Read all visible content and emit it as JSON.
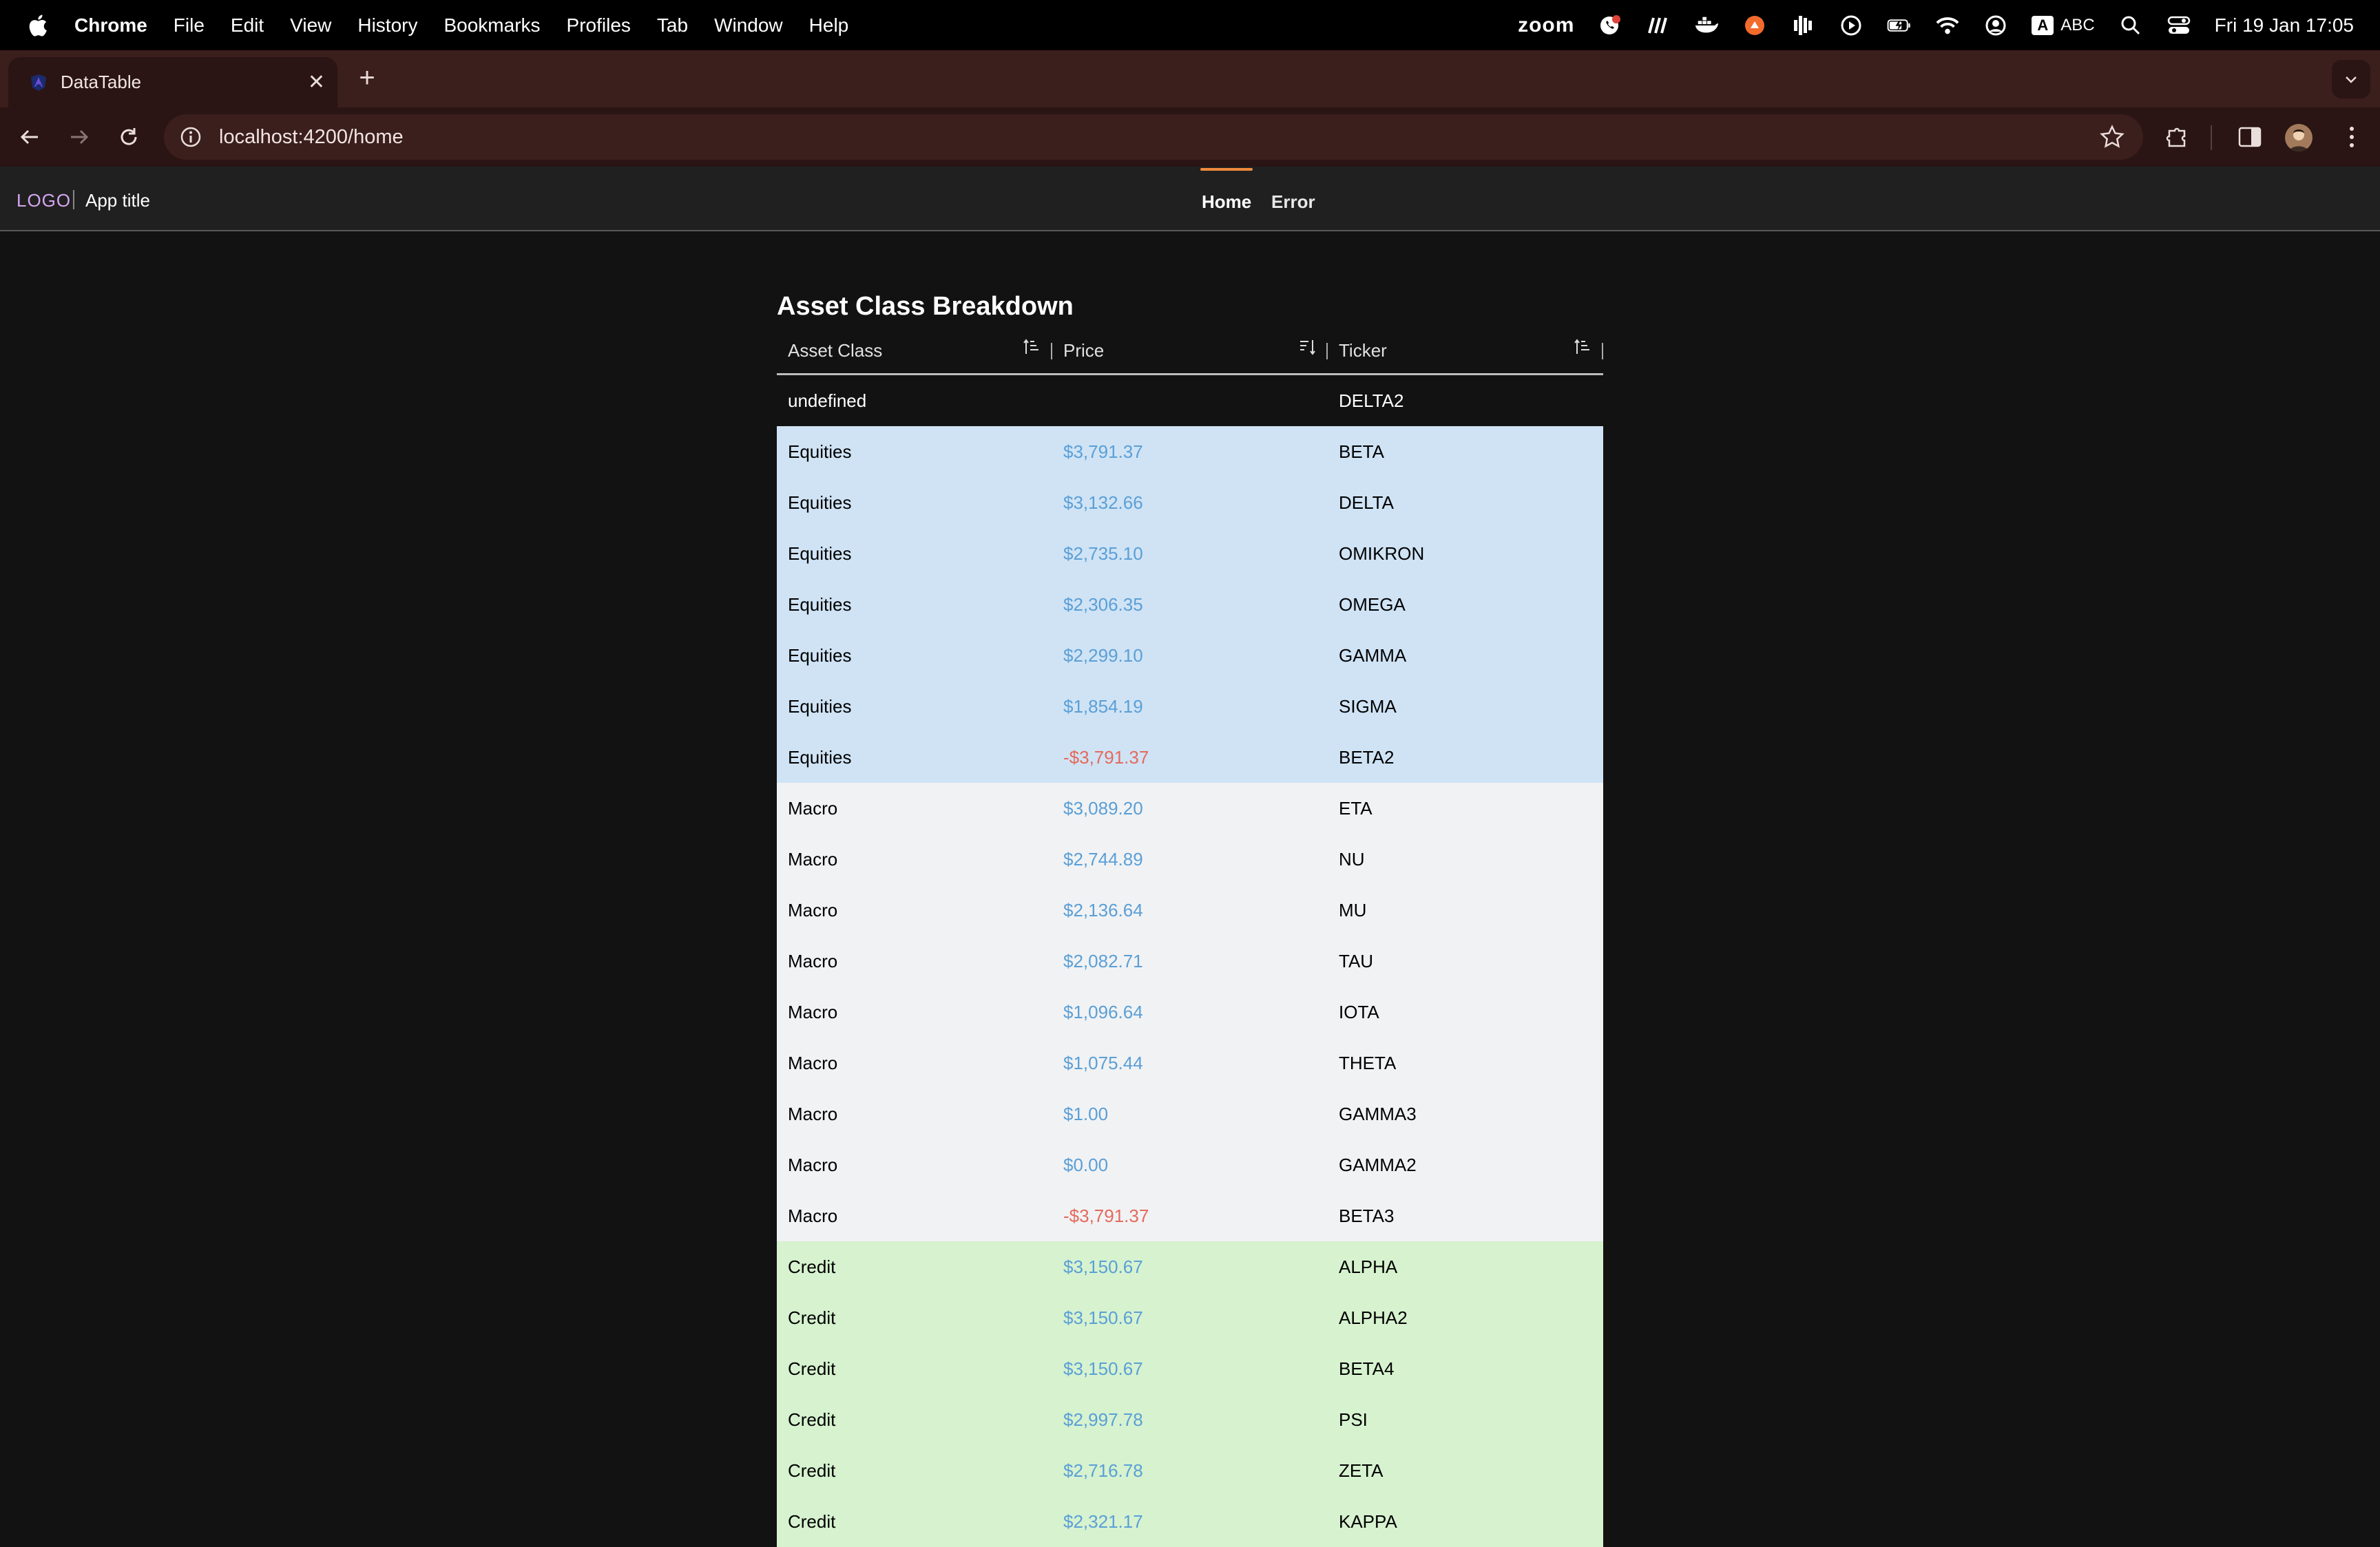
{
  "menubar": {
    "app_name": "Chrome",
    "items": [
      "File",
      "Edit",
      "View",
      "History",
      "Bookmarks",
      "Profiles",
      "Tab",
      "Window",
      "Help"
    ],
    "status": {
      "zoom_label": "zoom",
      "input_badge": "A",
      "input_label": "ABC",
      "clock": "Fri 19 Jan  17:05"
    }
  },
  "browser": {
    "tab_title": "DataTable",
    "url": "localhost:4200/home"
  },
  "app": {
    "logo": "LOGO",
    "title": "App title",
    "nav": [
      {
        "label": "Home",
        "active": true
      },
      {
        "label": "Error",
        "active": false
      }
    ]
  },
  "table": {
    "title": "Asset Class Breakdown",
    "columns": [
      "Asset Class",
      "Price",
      "Ticker"
    ],
    "rows": [
      {
        "asset_class": "undefined",
        "price": "",
        "ticker": "DELTA2",
        "group": "none"
      },
      {
        "asset_class": "Equities",
        "price": "$3,791.37",
        "ticker": "BETA",
        "group": "equities"
      },
      {
        "asset_class": "Equities",
        "price": "$3,132.66",
        "ticker": "DELTA",
        "group": "equities"
      },
      {
        "asset_class": "Equities",
        "price": "$2,735.10",
        "ticker": "OMIKRON",
        "group": "equities"
      },
      {
        "asset_class": "Equities",
        "price": "$2,306.35",
        "ticker": "OMEGA",
        "group": "equities"
      },
      {
        "asset_class": "Equities",
        "price": "$2,299.10",
        "ticker": "GAMMA",
        "group": "equities"
      },
      {
        "asset_class": "Equities",
        "price": "$1,854.19",
        "ticker": "SIGMA",
        "group": "equities"
      },
      {
        "asset_class": "Equities",
        "price": "-$3,791.37",
        "ticker": "BETA2",
        "group": "equities"
      },
      {
        "asset_class": "Macro",
        "price": "$3,089.20",
        "ticker": "ETA",
        "group": "macro"
      },
      {
        "asset_class": "Macro",
        "price": "$2,744.89",
        "ticker": "NU",
        "group": "macro"
      },
      {
        "asset_class": "Macro",
        "price": "$2,136.64",
        "ticker": "MU",
        "group": "macro"
      },
      {
        "asset_class": "Macro",
        "price": "$2,082.71",
        "ticker": "TAU",
        "group": "macro"
      },
      {
        "asset_class": "Macro",
        "price": "$1,096.64",
        "ticker": "IOTA",
        "group": "macro"
      },
      {
        "asset_class": "Macro",
        "price": "$1,075.44",
        "ticker": "THETA",
        "group": "macro"
      },
      {
        "asset_class": "Macro",
        "price": "$1.00",
        "ticker": "GAMMA3",
        "group": "macro"
      },
      {
        "asset_class": "Macro",
        "price": "$0.00",
        "ticker": "GAMMA2",
        "group": "macro"
      },
      {
        "asset_class": "Macro",
        "price": "-$3,791.37",
        "ticker": "BETA3",
        "group": "macro"
      },
      {
        "asset_class": "Credit",
        "price": "$3,150.67",
        "ticker": "ALPHA",
        "group": "credit"
      },
      {
        "asset_class": "Credit",
        "price": "$3,150.67",
        "ticker": "ALPHA2",
        "group": "credit"
      },
      {
        "asset_class": "Credit",
        "price": "$3,150.67",
        "ticker": "BETA4",
        "group": "credit"
      },
      {
        "asset_class": "Credit",
        "price": "$2,997.78",
        "ticker": "PSI",
        "group": "credit"
      },
      {
        "asset_class": "Credit",
        "price": "$2,716.78",
        "ticker": "ZETA",
        "group": "credit"
      },
      {
        "asset_class": "Credit",
        "price": "$2,321.17",
        "ticker": "KAPPA",
        "group": "credit"
      }
    ],
    "group_colors": {
      "none": "#121212",
      "equities": "#cfe3f5",
      "macro": "#f1f2f4",
      "credit": "#d6f2cf"
    },
    "price_colors": {
      "positive": "#5b9fd6",
      "negative": "#e56a5c"
    }
  }
}
